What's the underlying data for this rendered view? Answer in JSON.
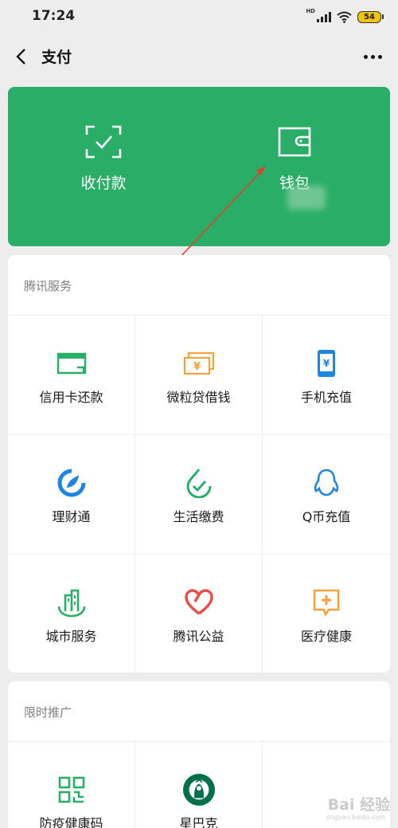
{
  "status_bar": {
    "time": "17:24",
    "network": "HD",
    "battery": "54"
  },
  "nav": {
    "title": "支付"
  },
  "pay_card": {
    "actions": [
      {
        "label": "收付款",
        "icon": "scan-qr-icon"
      },
      {
        "label": "钱包",
        "icon": "wallet-icon"
      }
    ]
  },
  "tencent_services": {
    "title": "腾讯服务",
    "items": [
      {
        "label": "信用卡还款",
        "icon": "credit-card-icon",
        "color": "#2aae67"
      },
      {
        "label": "微粒贷借钱",
        "icon": "loan-icon",
        "color": "#f2a33a"
      },
      {
        "label": "手机充值",
        "icon": "phone-topup-icon",
        "color": "#1f86e0"
      },
      {
        "label": "理财通",
        "icon": "wealth-icon",
        "color": "#1f86e0"
      },
      {
        "label": "生活缴费",
        "icon": "utility-bill-icon",
        "color": "#2aae67"
      },
      {
        "label": "Q币充值",
        "icon": "qq-penguin-icon",
        "color": "#1f86e0"
      },
      {
        "label": "城市服务",
        "icon": "city-services-icon",
        "color": "#2aae67"
      },
      {
        "label": "腾讯公益",
        "icon": "charity-heart-icon",
        "color": "#e7504a"
      },
      {
        "label": "医疗健康",
        "icon": "medical-icon",
        "color": "#f2a33a"
      }
    ]
  },
  "promotions": {
    "title": "限时推广",
    "items": [
      {
        "label": "防疫健康码",
        "icon": "health-code-icon",
        "color": "#2aae67"
      },
      {
        "label": "星巴克",
        "icon": "starbucks-logo-icon",
        "color": "#00704a"
      }
    ]
  },
  "watermark": {
    "main": "Bai 经验",
    "sub": "jingyan.baidu.com"
  }
}
